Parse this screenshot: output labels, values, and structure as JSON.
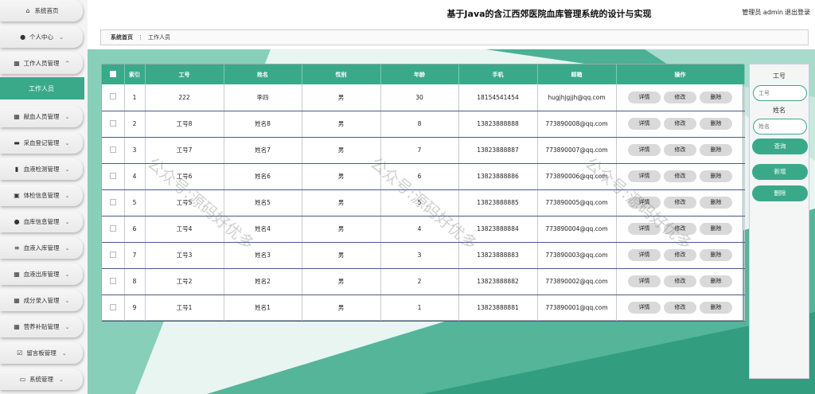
{
  "header": {
    "title": "基于Java的含江西郊医院血库管理系统的设计与实现",
    "user": "管理员 admin",
    "logout": "退出登录"
  },
  "sidebar": {
    "items": [
      {
        "label": "系统首页",
        "icon": "home-icon",
        "glyph": "⌂",
        "chevron": false
      },
      {
        "label": "个人中心",
        "icon": "user-icon",
        "glyph": "●",
        "chevron": true
      },
      {
        "label": "工作人员管理",
        "icon": "grid-icon",
        "glyph": "▦",
        "chevron": true,
        "expanded": true
      },
      {
        "label": "献血人员管理",
        "icon": "grid-icon",
        "glyph": "▦",
        "chevron": true
      },
      {
        "label": "采血登记管理",
        "icon": "chat-icon",
        "glyph": "▬",
        "chevron": true
      },
      {
        "label": "血液检测管理",
        "icon": "bar-chart-icon",
        "glyph": "▮",
        "chevron": true
      },
      {
        "label": "体检信息管理",
        "icon": "briefcase-icon",
        "glyph": "▣",
        "chevron": true
      },
      {
        "label": "血库信息管理",
        "icon": "user-icon",
        "glyph": "●",
        "chevron": true
      },
      {
        "label": "血液入库管理",
        "icon": "list-icon",
        "glyph": "≡",
        "chevron": true
      },
      {
        "label": "血液出库管理",
        "icon": "grid-icon",
        "glyph": "▦",
        "chevron": true
      },
      {
        "label": "成分录入管理",
        "icon": "grid-icon",
        "glyph": "▦",
        "chevron": true
      },
      {
        "label": "营养补贴管理",
        "icon": "grid-icon",
        "glyph": "▦",
        "chevron": true
      },
      {
        "label": "留言板管理",
        "icon": "checkbox-icon",
        "glyph": "☑",
        "chevron": true
      },
      {
        "label": "系统管理",
        "icon": "monitor-icon",
        "glyph": "▭",
        "chevron": true
      }
    ],
    "active_sub": "工作人员"
  },
  "breadcrumb": {
    "home": "系统首页",
    "separator": "⋮",
    "current": "工作人员"
  },
  "table": {
    "columns": [
      "",
      "索引",
      "工号",
      "姓名",
      "性别",
      "年龄",
      "手机",
      "邮箱",
      "操作"
    ],
    "rows": [
      {
        "index": "1",
        "job_no": "222",
        "name": "李四",
        "gender": "男",
        "age": "30",
        "phone": "18154541454",
        "email": "hugjhjgjjh@qq.com"
      },
      {
        "index": "2",
        "job_no": "工号8",
        "name": "姓名8",
        "gender": "男",
        "age": "8",
        "phone": "13823888888",
        "email": "773890008@qq.com"
      },
      {
        "index": "3",
        "job_no": "工号7",
        "name": "姓名7",
        "gender": "男",
        "age": "7",
        "phone": "13823888887",
        "email": "773890007@qq.com"
      },
      {
        "index": "4",
        "job_no": "工号6",
        "name": "姓名6",
        "gender": "男",
        "age": "6",
        "phone": "13823888886",
        "email": "773890006@qq.com"
      },
      {
        "index": "5",
        "job_no": "工号5",
        "name": "姓名5",
        "gender": "男",
        "age": "5",
        "phone": "13823888885",
        "email": "773890005@qq.com"
      },
      {
        "index": "6",
        "job_no": "工号4",
        "name": "姓名4",
        "gender": "男",
        "age": "4",
        "phone": "13823888884",
        "email": "773890004@qq.com"
      },
      {
        "index": "7",
        "job_no": "工号3",
        "name": "姓名3",
        "gender": "男",
        "age": "3",
        "phone": "13823888883",
        "email": "773890003@qq.com"
      },
      {
        "index": "8",
        "job_no": "工号2",
        "name": "姓名2",
        "gender": "男",
        "age": "2",
        "phone": "13823888882",
        "email": "773890002@qq.com"
      },
      {
        "index": "9",
        "job_no": "工号1",
        "name": "姓名1",
        "gender": "男",
        "age": "1",
        "phone": "13823888881",
        "email": "773890001@qq.com"
      }
    ],
    "actions": {
      "detail": "详情",
      "edit": "修改",
      "delete": "删除"
    }
  },
  "search": {
    "job_no_label": "工号",
    "job_no_placeholder": "工号",
    "name_label": "姓名",
    "name_placeholder": "姓名",
    "query_button": "查询",
    "add_button": "新增",
    "delete_button": "删除"
  },
  "watermark": "公众号:源码好优多",
  "colors": {
    "accent": "#3aa98a"
  }
}
